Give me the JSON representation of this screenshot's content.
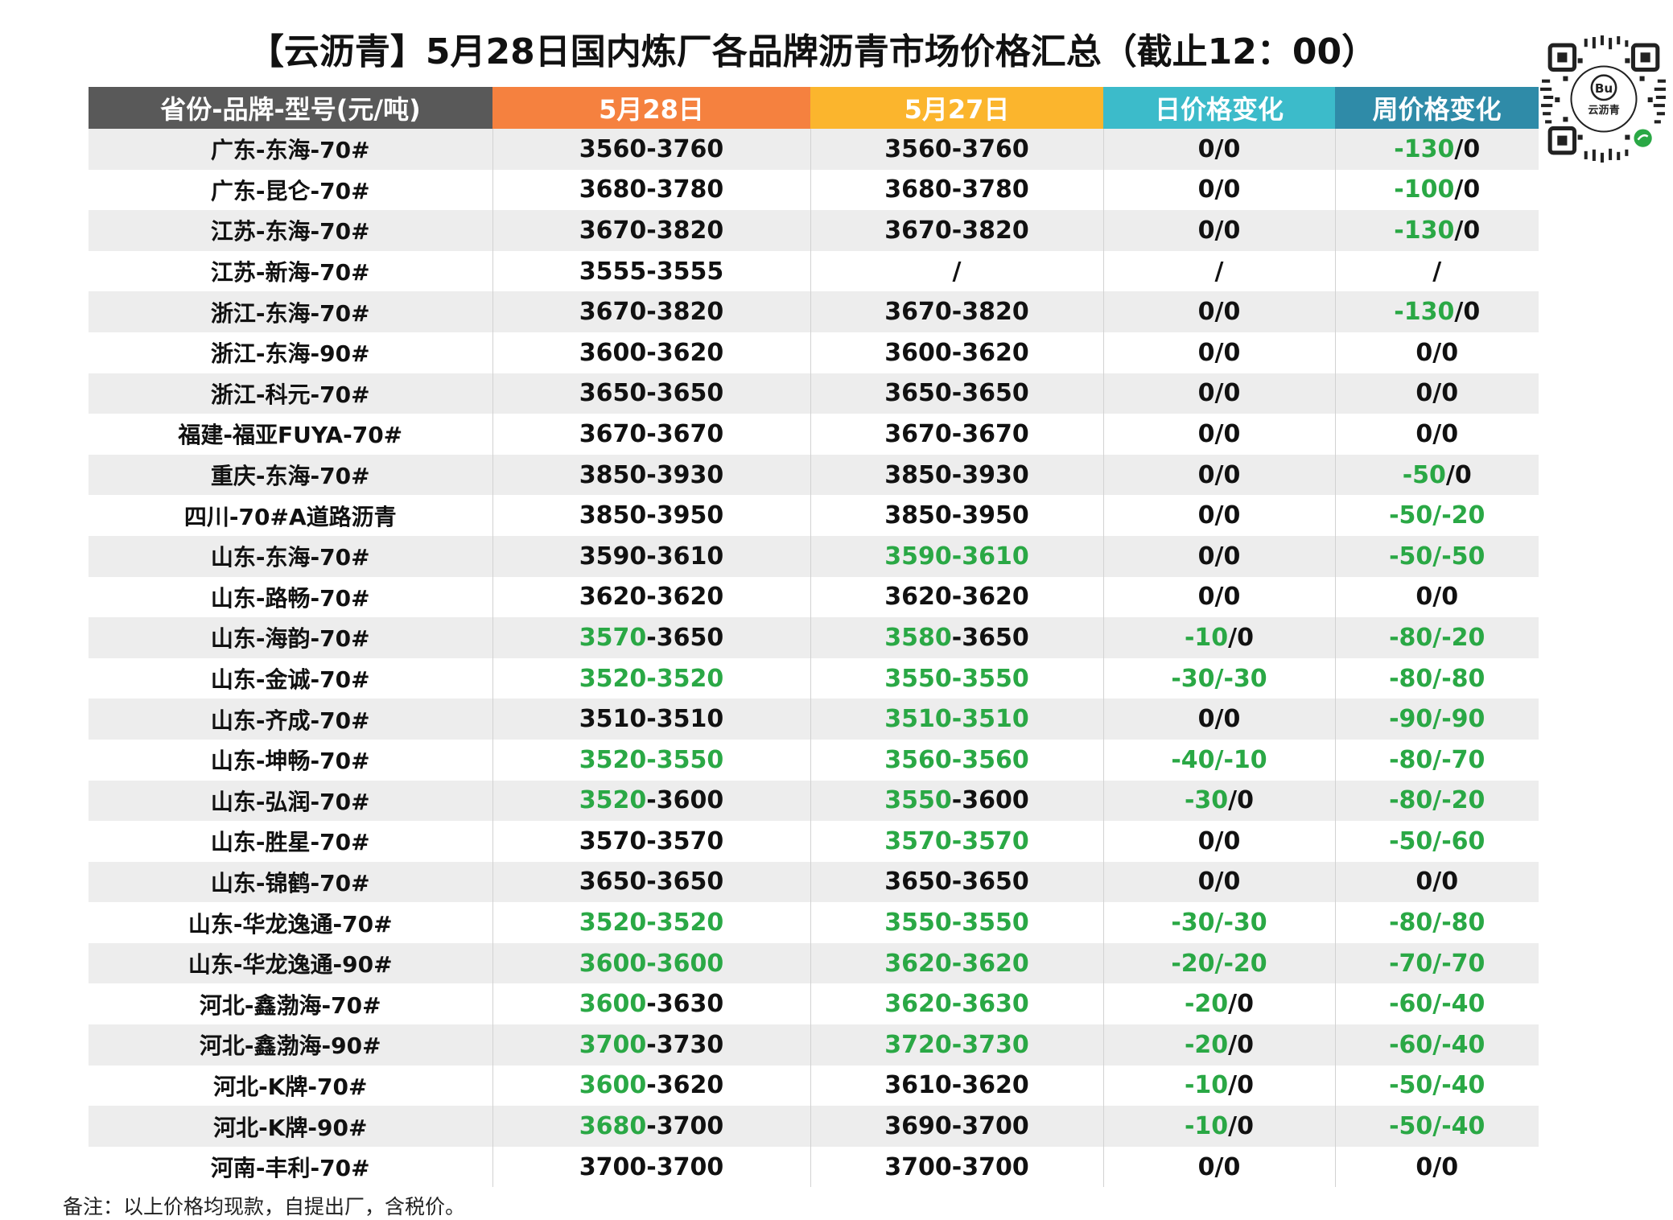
{
  "title": "【云沥青】5月28日国内炼厂各品牌沥青市场价格汇总（截止12：00）",
  "colors": {
    "green": "#2aa845",
    "black": "#111111"
  },
  "qr": {
    "caption": "云沥青"
  },
  "table": {
    "headers": [
      "省份-品牌-型号(元/吨)",
      "5月28日",
      "5月27日",
      "日价格变化",
      "周价格变化"
    ],
    "rows": [
      [
        [
          [
            "广东-东海-70#",
            "k"
          ]
        ],
        [
          [
            "3560-3760",
            "k"
          ]
        ],
        [
          [
            "3560-3760",
            "k"
          ]
        ],
        [
          [
            "0/0",
            "k"
          ]
        ],
        [
          [
            "-130",
            "g"
          ],
          [
            "/0",
            "k"
          ]
        ]
      ],
      [
        [
          [
            "广东-昆仑-70#",
            "k"
          ]
        ],
        [
          [
            "3680-3780",
            "k"
          ]
        ],
        [
          [
            "3680-3780",
            "k"
          ]
        ],
        [
          [
            "0/0",
            "k"
          ]
        ],
        [
          [
            "-100",
            "g"
          ],
          [
            "/0",
            "k"
          ]
        ]
      ],
      [
        [
          [
            "江苏-东海-70#",
            "k"
          ]
        ],
        [
          [
            "3670-3820",
            "k"
          ]
        ],
        [
          [
            "3670-3820",
            "k"
          ]
        ],
        [
          [
            "0/0",
            "k"
          ]
        ],
        [
          [
            "-130",
            "g"
          ],
          [
            "/0",
            "k"
          ]
        ]
      ],
      [
        [
          [
            "江苏-新海-70#",
            "k"
          ]
        ],
        [
          [
            "3555-3555",
            "k"
          ]
        ],
        [
          [
            "/",
            "k"
          ]
        ],
        [
          [
            "/",
            "k"
          ]
        ],
        [
          [
            "/",
            "k"
          ]
        ]
      ],
      [
        [
          [
            "浙江-东海-70#",
            "k"
          ]
        ],
        [
          [
            "3670-3820",
            "k"
          ]
        ],
        [
          [
            "3670-3820",
            "k"
          ]
        ],
        [
          [
            "0/0",
            "k"
          ]
        ],
        [
          [
            "-130",
            "g"
          ],
          [
            "/0",
            "k"
          ]
        ]
      ],
      [
        [
          [
            "浙江-东海-90#",
            "k"
          ]
        ],
        [
          [
            "3600-3620",
            "k"
          ]
        ],
        [
          [
            "3600-3620",
            "k"
          ]
        ],
        [
          [
            "0/0",
            "k"
          ]
        ],
        [
          [
            "0/0",
            "k"
          ]
        ]
      ],
      [
        [
          [
            "浙江-科元-70#",
            "k"
          ]
        ],
        [
          [
            "3650-3650",
            "k"
          ]
        ],
        [
          [
            "3650-3650",
            "k"
          ]
        ],
        [
          [
            "0/0",
            "k"
          ]
        ],
        [
          [
            "0/0",
            "k"
          ]
        ]
      ],
      [
        [
          [
            "福建-福亚FUYA-70#",
            "k"
          ]
        ],
        [
          [
            "3670-3670",
            "k"
          ]
        ],
        [
          [
            "3670-3670",
            "k"
          ]
        ],
        [
          [
            "0/0",
            "k"
          ]
        ],
        [
          [
            "0/0",
            "k"
          ]
        ]
      ],
      [
        [
          [
            "重庆-东海-70#",
            "k"
          ]
        ],
        [
          [
            "3850-3930",
            "k"
          ]
        ],
        [
          [
            "3850-3930",
            "k"
          ]
        ],
        [
          [
            "0/0",
            "k"
          ]
        ],
        [
          [
            "-50",
            "g"
          ],
          [
            "/0",
            "k"
          ]
        ]
      ],
      [
        [
          [
            "四川-70#A道路沥青",
            "k"
          ]
        ],
        [
          [
            "3850-3950",
            "k"
          ]
        ],
        [
          [
            "3850-3950",
            "k"
          ]
        ],
        [
          [
            "0/0",
            "k"
          ]
        ],
        [
          [
            "-50/-20",
            "g"
          ]
        ]
      ],
      [
        [
          [
            "山东-东海-70#",
            "k"
          ]
        ],
        [
          [
            "3590-3610",
            "k"
          ]
        ],
        [
          [
            "3590-3610",
            "g"
          ]
        ],
        [
          [
            "0/0",
            "k"
          ]
        ],
        [
          [
            "-50/-50",
            "g"
          ]
        ]
      ],
      [
        [
          [
            "山东-路畅-70#",
            "k"
          ]
        ],
        [
          [
            "3620-3620",
            "k"
          ]
        ],
        [
          [
            "3620-3620",
            "k"
          ]
        ],
        [
          [
            "0/0",
            "k"
          ]
        ],
        [
          [
            "0/0",
            "k"
          ]
        ]
      ],
      [
        [
          [
            "山东-海韵-70#",
            "k"
          ]
        ],
        [
          [
            "3570",
            "g"
          ],
          [
            "-3650",
            "k"
          ]
        ],
        [
          [
            "3580",
            "g"
          ],
          [
            "-3650",
            "k"
          ]
        ],
        [
          [
            "-10",
            "g"
          ],
          [
            "/0",
            "k"
          ]
        ],
        [
          [
            "-80/-20",
            "g"
          ]
        ]
      ],
      [
        [
          [
            "山东-金诚-70#",
            "k"
          ]
        ],
        [
          [
            "3520-3520",
            "g"
          ]
        ],
        [
          [
            "3550-3550",
            "g"
          ]
        ],
        [
          [
            "-30/-30",
            "g"
          ]
        ],
        [
          [
            "-80/-80",
            "g"
          ]
        ]
      ],
      [
        [
          [
            "山东-齐成-70#",
            "k"
          ]
        ],
        [
          [
            "3510-3510",
            "k"
          ]
        ],
        [
          [
            "3510-3510",
            "g"
          ]
        ],
        [
          [
            "0/0",
            "k"
          ]
        ],
        [
          [
            "-90/-90",
            "g"
          ]
        ]
      ],
      [
        [
          [
            "山东-坤畅-70#",
            "k"
          ]
        ],
        [
          [
            "3520-3550",
            "g"
          ]
        ],
        [
          [
            "3560-3560",
            "g"
          ]
        ],
        [
          [
            "-40/-10",
            "g"
          ]
        ],
        [
          [
            "-80/-70",
            "g"
          ]
        ]
      ],
      [
        [
          [
            "山东-弘润-70#",
            "k"
          ]
        ],
        [
          [
            "3520",
            "g"
          ],
          [
            "-3600",
            "k"
          ]
        ],
        [
          [
            "3550",
            "g"
          ],
          [
            "-3600",
            "k"
          ]
        ],
        [
          [
            "-30",
            "g"
          ],
          [
            "/0",
            "k"
          ]
        ],
        [
          [
            "-80/-20",
            "g"
          ]
        ]
      ],
      [
        [
          [
            "山东-胜星-70#",
            "k"
          ]
        ],
        [
          [
            "3570-3570",
            "k"
          ]
        ],
        [
          [
            "3570-3570",
            "g"
          ]
        ],
        [
          [
            "0/0",
            "k"
          ]
        ],
        [
          [
            "-50/-60",
            "g"
          ]
        ]
      ],
      [
        [
          [
            "山东-锦鹤-70#",
            "k"
          ]
        ],
        [
          [
            "3650-3650",
            "k"
          ]
        ],
        [
          [
            "3650-3650",
            "k"
          ]
        ],
        [
          [
            "0/0",
            "k"
          ]
        ],
        [
          [
            "0/0",
            "k"
          ]
        ]
      ],
      [
        [
          [
            "山东-华龙逸通-70#",
            "k"
          ]
        ],
        [
          [
            "3520-3520",
            "g"
          ]
        ],
        [
          [
            "3550-3550",
            "g"
          ]
        ],
        [
          [
            "-30/-30",
            "g"
          ]
        ],
        [
          [
            "-80/-80",
            "g"
          ]
        ]
      ],
      [
        [
          [
            "山东-华龙逸通-90#",
            "k"
          ]
        ],
        [
          [
            "3600-3600",
            "g"
          ]
        ],
        [
          [
            "3620-3620",
            "g"
          ]
        ],
        [
          [
            "-20/-20",
            "g"
          ]
        ],
        [
          [
            "-70/-70",
            "g"
          ]
        ]
      ],
      [
        [
          [
            "河北-鑫渤海-70#",
            "k"
          ]
        ],
        [
          [
            "3600",
            "g"
          ],
          [
            "-3630",
            "k"
          ]
        ],
        [
          [
            "3620-3630",
            "g"
          ]
        ],
        [
          [
            "-20",
            "g"
          ],
          [
            "/0",
            "k"
          ]
        ],
        [
          [
            "-60/-40",
            "g"
          ]
        ]
      ],
      [
        [
          [
            "河北-鑫渤海-90#",
            "k"
          ]
        ],
        [
          [
            "3700",
            "g"
          ],
          [
            "-3730",
            "k"
          ]
        ],
        [
          [
            "3720-3730",
            "g"
          ]
        ],
        [
          [
            "-20",
            "g"
          ],
          [
            "/0",
            "k"
          ]
        ],
        [
          [
            "-60/-40",
            "g"
          ]
        ]
      ],
      [
        [
          [
            "河北-K牌-70#",
            "k"
          ]
        ],
        [
          [
            "3600",
            "g"
          ],
          [
            "-3620",
            "k"
          ]
        ],
        [
          [
            "3610-3620",
            "k"
          ]
        ],
        [
          [
            "-10",
            "g"
          ],
          [
            "/0",
            "k"
          ]
        ],
        [
          [
            "-50/-40",
            "g"
          ]
        ]
      ],
      [
        [
          [
            "河北-K牌-90#",
            "k"
          ]
        ],
        [
          [
            "3680",
            "g"
          ],
          [
            "-3700",
            "k"
          ]
        ],
        [
          [
            "3690-3700",
            "k"
          ]
        ],
        [
          [
            "-10",
            "g"
          ],
          [
            "/0",
            "k"
          ]
        ],
        [
          [
            "-50/-40",
            "g"
          ]
        ]
      ],
      [
        [
          [
            "河南-丰利-70#",
            "k"
          ]
        ],
        [
          [
            "3700-3700",
            "k"
          ]
        ],
        [
          [
            "3700-3700",
            "k"
          ]
        ],
        [
          [
            "0/0",
            "k"
          ]
        ],
        [
          [
            "0/0",
            "k"
          ]
        ]
      ]
    ]
  },
  "note": "备注：以上价格均现款，自提出厂，含税价。"
}
